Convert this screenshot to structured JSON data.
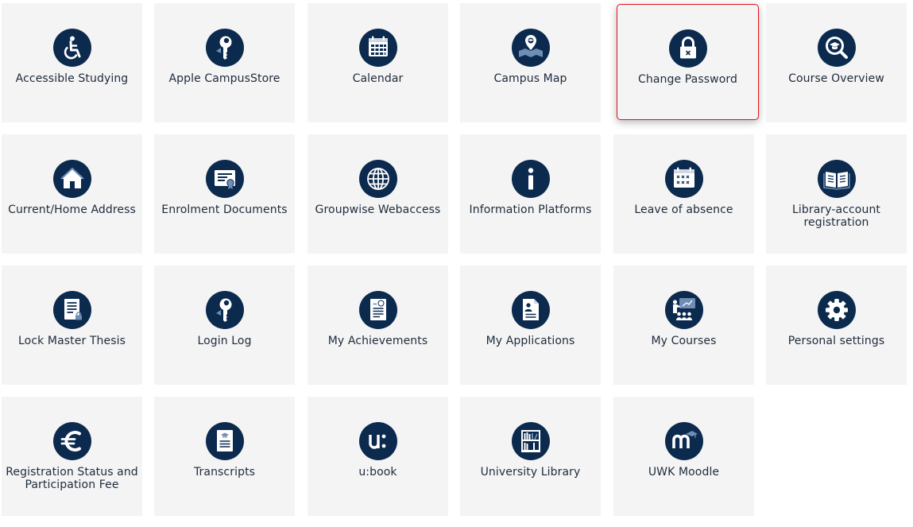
{
  "colors": {
    "tile_bg": "#f4f4f5",
    "icon_bg": "#0b2a4e",
    "label": "#1e2b3a",
    "highlight_border": "#e3101b"
  },
  "tiles": [
    {
      "label": "Accessible Studying",
      "icon": "wheelchair-icon"
    },
    {
      "label": "Apple CampusStore",
      "icon": "apple-key-icon"
    },
    {
      "label": "Calendar",
      "icon": "calendar-icon"
    },
    {
      "label": "Campus Map",
      "icon": "map-pin-icon"
    },
    {
      "label": "Change Password",
      "icon": "lock-icon",
      "highlighted": true
    },
    {
      "label": "Course Overview",
      "icon": "magnifier-graduation-icon"
    },
    {
      "label": "Current/Home Address",
      "icon": "house-icon"
    },
    {
      "label": "Enrolment Documents",
      "icon": "certificate-icon"
    },
    {
      "label": "Groupwise Webaccess",
      "icon": "globe-icon"
    },
    {
      "label": "Information Platforms",
      "icon": "info-icon"
    },
    {
      "label": "Leave of absence",
      "icon": "calendar-crossed-icon"
    },
    {
      "label": "Library-account registration",
      "icon": "open-book-icon"
    },
    {
      "label": "Lock Master Thesis",
      "icon": "document-lock-icon"
    },
    {
      "label": "Login Log",
      "icon": "key-icon"
    },
    {
      "label": "My Achievements",
      "icon": "graded-document-icon"
    },
    {
      "label": "My Applications",
      "icon": "application-document-icon"
    },
    {
      "label": "My Courses",
      "icon": "classroom-icon"
    },
    {
      "label": "Personal settings",
      "icon": "gear-icon"
    },
    {
      "label": "Registration Status and Participation Fee",
      "icon": "euro-icon"
    },
    {
      "label": "Transcripts",
      "icon": "transcript-icon"
    },
    {
      "label": "u:book",
      "icon": "ubook-icon"
    },
    {
      "label": "University Library",
      "icon": "bookshelf-icon"
    },
    {
      "label": "UWK Moodle",
      "icon": "moodle-icon"
    }
  ]
}
